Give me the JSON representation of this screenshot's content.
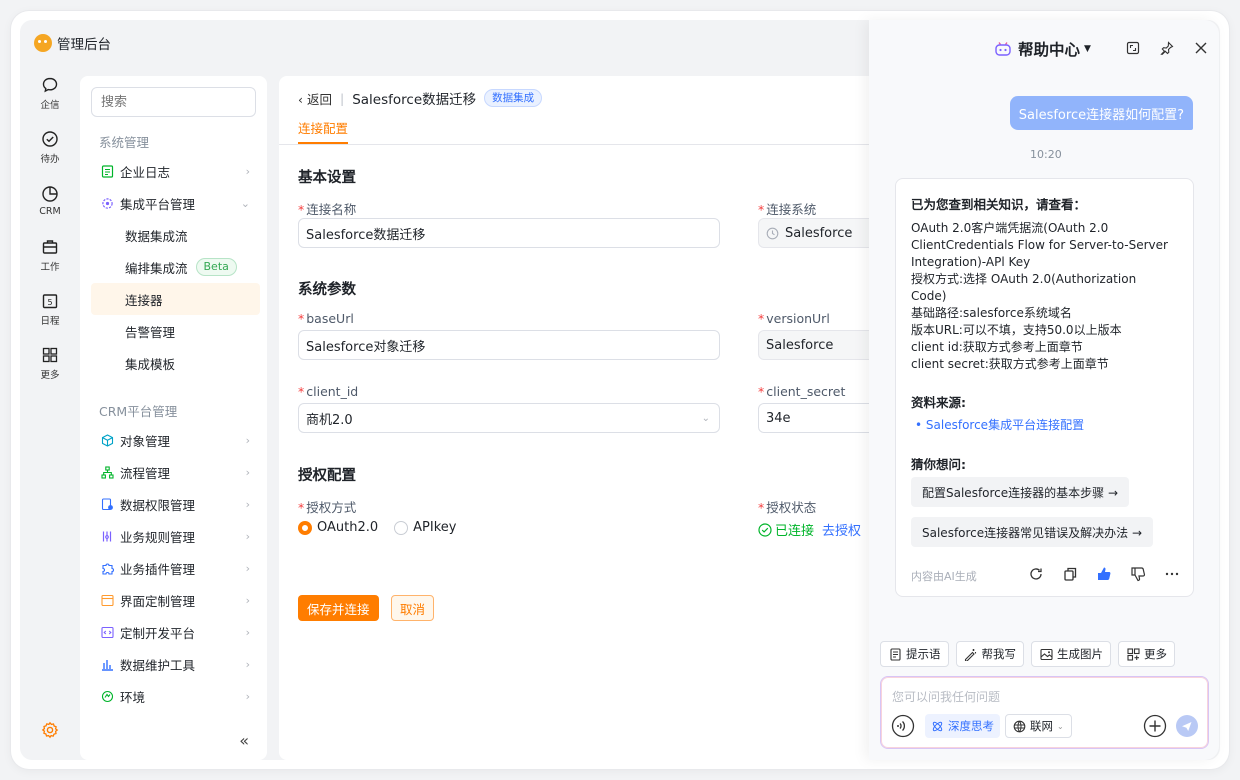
{
  "app": {
    "title": "管理后台"
  },
  "rail": [
    {
      "label": "企信",
      "icon": "chat-bubble-icon"
    },
    {
      "label": "待办",
      "icon": "check-circle-icon"
    },
    {
      "label": "CRM",
      "icon": "pie-chart-icon"
    },
    {
      "label": "工作",
      "icon": "briefcase-icon"
    },
    {
      "label": "日程",
      "icon": "calendar-icon",
      "day": "5"
    },
    {
      "label": "更多",
      "icon": "grid-icon"
    }
  ],
  "sidebar": {
    "search_placeholder": "搜索",
    "group1": "系统管理",
    "items1": [
      {
        "label": "企业日志"
      },
      {
        "label": "集成平台管理"
      }
    ],
    "subitems": [
      {
        "label": "数据集成流"
      },
      {
        "label": "编排集成流",
        "badge": "Beta"
      },
      {
        "label": "连接器"
      },
      {
        "label": "告警管理"
      },
      {
        "label": "集成模板"
      }
    ],
    "group2": "CRM平台管理",
    "items2": [
      {
        "label": "对象管理"
      },
      {
        "label": "流程管理"
      },
      {
        "label": "数据权限管理"
      },
      {
        "label": "业务规则管理"
      },
      {
        "label": "业务插件管理"
      },
      {
        "label": "界面定制管理"
      },
      {
        "label": "定制开发平台"
      },
      {
        "label": "数据维护工具"
      },
      {
        "label": "环境"
      }
    ]
  },
  "main": {
    "back": "返回",
    "title": "Salesforce数据迁移",
    "tag": "数据集成",
    "tab": "连接配置",
    "basic": {
      "title": "基本设置",
      "name_label": "连接名称",
      "name_value": "Salesforce数据迁移",
      "system_label": "连接系统",
      "system_value": "Salesforce"
    },
    "params": {
      "title": "系统参数",
      "baseurl_label": "baseUrl",
      "baseurl_value": "Salesforce对象迁移",
      "versionurl_label": "versionUrl",
      "versionurl_value": "Salesforce",
      "clientid_label": "client_id",
      "clientid_value": "商机2.0",
      "secret_label": "client_secret",
      "secret_value": "34e"
    },
    "auth": {
      "title": "授权配置",
      "mode_label": "授权方式",
      "opt1": "OAuth2.0",
      "opt2": "APIkey",
      "status_label": "授权状态",
      "status_ok": "已连接",
      "status_go": "去授权"
    },
    "save": "保存并连接",
    "cancel": "取消"
  },
  "help": {
    "title": "帮助中心",
    "question": "Salesforce连接器如何配置?",
    "time": "10:20",
    "answer_head": "已为您查到相关知识，请查看：",
    "answer_lines": [
      "OAuth 2.0客户端凭据流(OAuth 2.0",
      "ClientCredentials Flow for Server-to-Server",
      "Integration)-APl Key",
      "授权方式:选择 OAuth 2.0(Authorization",
      "Code)",
      "基础路径:salesforce系统域名",
      "版本URL:可以不填，支持50.0以上版本",
      "client id:获取方式参考上面章节",
      "client secret:获取方式参考上面章节"
    ],
    "source_head": "资料来源:",
    "source_link": "Salesforce集成平台连接配置",
    "guess_head": "猜你想问:",
    "suggestions": [
      "配置Salesforce连接器的基本步骤 →",
      "Salesforce连接器常见错误及解决办法 →"
    ],
    "ai_note": "内容由AI生成",
    "tools": [
      {
        "label": "提示语"
      },
      {
        "label": "帮我写"
      },
      {
        "label": "生成图片"
      },
      {
        "label": "更多"
      }
    ],
    "input_placeholder": "您可以问我任何问题",
    "deep": "深度思考",
    "web": "联网"
  },
  "colors": {
    "accent": "#ff7d00",
    "link": "#3370ff",
    "success": "#00b42a"
  }
}
